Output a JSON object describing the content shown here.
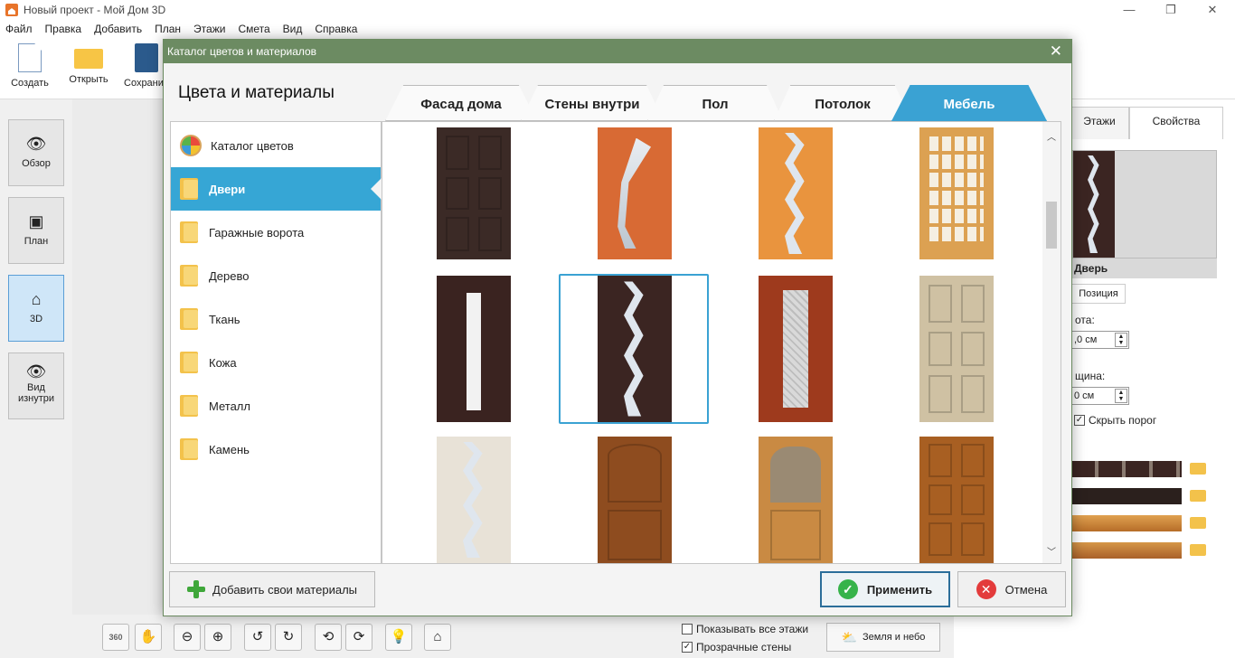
{
  "window": {
    "title": "Новый проект - Мой Дом 3D",
    "minimize": "—",
    "maximize": "❐",
    "close": "✕"
  },
  "menu": [
    "Файл",
    "Правка",
    "Добавить",
    "План",
    "Этажи",
    "Смета",
    "Вид",
    "Справка"
  ],
  "toolbar": {
    "create": "Создать",
    "open": "Открыть",
    "save": "Сохрани"
  },
  "left_nav": [
    {
      "label": "Обзор",
      "icon": "eye-icon"
    },
    {
      "label": "План",
      "icon": "plan-icon"
    },
    {
      "label": "3D",
      "icon": "cube-house-icon",
      "active": true
    },
    {
      "label": "Вид изнутри",
      "icon": "eye-icon"
    }
  ],
  "right_panel": {
    "tabs": [
      "Этажи",
      "Свойства"
    ],
    "object_name": "Дверь",
    "subtab": "Позиция",
    "height_label": "ота:",
    "height_value": ",0 см",
    "width_label": "щина:",
    "width_value": "0 см",
    "hide_threshold": "Скрыть порог"
  },
  "bottom": {
    "show_all_floors": "Показывать все этажи",
    "transparent_walls": "Прозрачные стены",
    "earth_sky": "Земля и небо",
    "rotate360_label": "360"
  },
  "dialog": {
    "title": "Каталог цветов и материалов",
    "close": "✕",
    "heading": "Цвета и материалы",
    "tabs": [
      "Фасад дома",
      "Стены внутри",
      "Пол",
      "Потолок",
      "Мебель"
    ],
    "active_tab": "Мебель",
    "categories": [
      "Каталог цветов",
      "Двери",
      "Гаражные ворота",
      "Дерево",
      "Ткань",
      "Кожа",
      "Металл",
      "Камень"
    ],
    "active_category": "Двери",
    "selected_swatch_index": 5,
    "swatches": [
      {
        "name": "dark-panel-door",
        "color": "#3b2a26"
      },
      {
        "name": "orange-glass-curve-door",
        "color": "#d86a34"
      },
      {
        "name": "light-orange-wave-door",
        "color": "#e9943e"
      },
      {
        "name": "grid-glass-door",
        "color": "#dca152"
      },
      {
        "name": "wenge-narrow-glass-door",
        "color": "#3a2320"
      },
      {
        "name": "wenge-wave-glass-door",
        "color": "#3b2522"
      },
      {
        "name": "red-ornament-glass-door",
        "color": "#9e3a1d"
      },
      {
        "name": "oak-light-panel-door",
        "color": "#cfc1a3"
      },
      {
        "name": "bleached-wave-door",
        "color": "#e8e2d7"
      },
      {
        "name": "brown-arch-door",
        "color": "#8e4c1f"
      },
      {
        "name": "oak-flower-glass-door",
        "color": "#c98a43"
      },
      {
        "name": "golden-panel-door",
        "color": "#a85f22"
      }
    ],
    "add_materials": "Добавить свои материалы",
    "apply": "Применить",
    "cancel": "Отмена"
  }
}
